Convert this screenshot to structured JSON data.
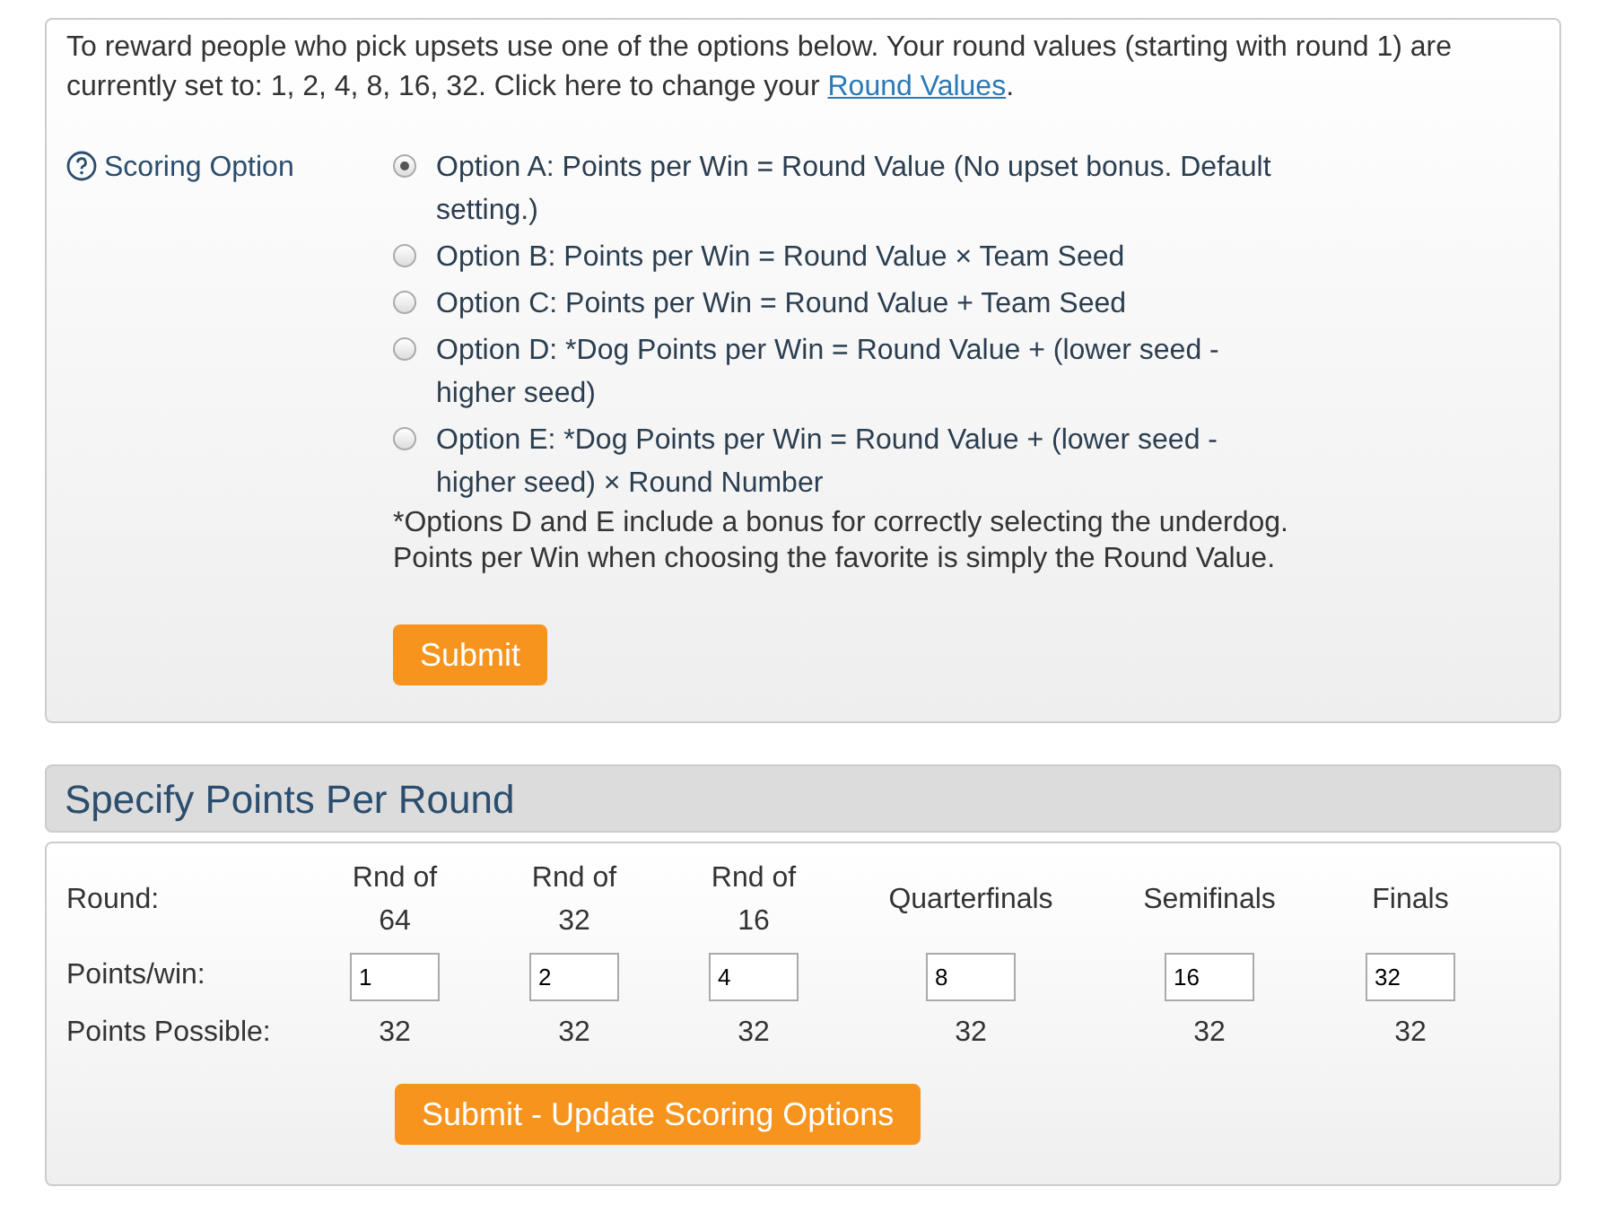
{
  "scoring_panel": {
    "intro": "To reward people who pick upsets use one of the options below. Your round values (starting with round 1) are currently set to: 1, 2, 4, 8, 16, 32. Click here to change your ",
    "intro_link": "Round Values",
    "intro_end": ".",
    "label": "Scoring Option",
    "options": [
      {
        "label": "Option A: Points per Win = Round Value (No upset bonus. Default setting.)",
        "selected": true
      },
      {
        "label": "Option B: Points per Win = Round Value × Team Seed",
        "selected": false
      },
      {
        "label": "Option C: Points per Win = Round Value + Team Seed",
        "selected": false
      },
      {
        "label": "Option D: *Dog Points per Win = Round Value + (lower seed - higher seed)",
        "selected": false
      },
      {
        "label": "Option E: *Dog Points per Win = Round Value + (lower seed - higher seed) × Round Number",
        "selected": false
      }
    ],
    "note": "*Options D and E include a bonus for correctly selecting the underdog. Points per Win when choosing the favorite is simply the Round Value.",
    "submit": "Submit"
  },
  "points_panel": {
    "title": "Specify Points Per Round",
    "row_labels": [
      "Round:",
      "Points/win:",
      "Points Possible:"
    ],
    "rounds": [
      {
        "name": "Rnd of 64",
        "value": "1",
        "possible": "32"
      },
      {
        "name": "Rnd of 32",
        "value": "2",
        "possible": "32"
      },
      {
        "name": "Rnd of 16",
        "value": "4",
        "possible": "32"
      },
      {
        "name": "Quarterfinals",
        "value": "8",
        "possible": "32"
      },
      {
        "name": "Semifinals",
        "value": "16",
        "possible": "32"
      },
      {
        "name": "Finals",
        "value": "32",
        "possible": "32"
      }
    ],
    "submit": "Submit - Update Scoring Options"
  }
}
